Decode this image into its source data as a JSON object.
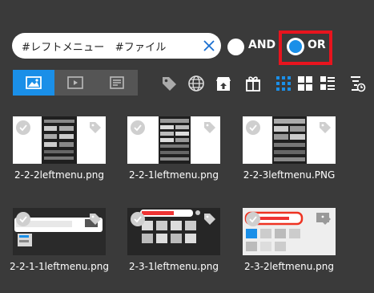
{
  "search": {
    "query": "#レフトメニュー　#ファイル",
    "clear_icon": "close-icon"
  },
  "match_mode": {
    "and_label": "AND",
    "or_label": "OR",
    "selected": "OR",
    "highlight_color": "#e8141e",
    "accent": "#1a8fe8"
  },
  "view_tabs": [
    {
      "icon": "image-icon",
      "active": true
    },
    {
      "icon": "video-icon",
      "active": false
    },
    {
      "icon": "document-icon",
      "active": false
    }
  ],
  "tools": [
    "tag-icon",
    "globe-icon",
    "upload-store-icon",
    "gift-icon",
    "grid-small-icon",
    "grid-large-icon",
    "list-icon",
    "sort-time-icon"
  ],
  "files": [
    {
      "name": "2-2-2leftmenu.png"
    },
    {
      "name": "2-2-1leftmenu.png"
    },
    {
      "name": "2-2-3leftmenu.PNG"
    },
    {
      "name": "2-2-1-1leftmenu.png"
    },
    {
      "name": "2-3-1leftmenu.png"
    },
    {
      "name": "2-3-2leftmenu.png"
    }
  ]
}
